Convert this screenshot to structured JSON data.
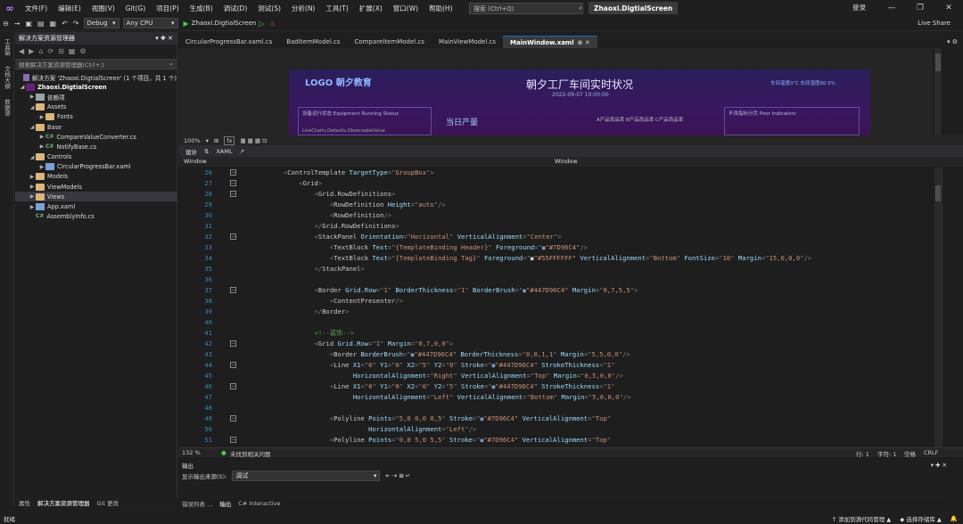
{
  "app": {
    "logo": "∞",
    "solution_title": "Zhaoxi.DigtialScreen",
    "login": "登录"
  },
  "menu": [
    "文件(F)",
    "编辑(E)",
    "视图(V)",
    "Git(G)",
    "项目(P)",
    "生成(B)",
    "调试(D)",
    "测试(S)",
    "分析(N)",
    "工具(T)",
    "扩展(X)",
    "窗口(W)",
    "帮助(H)"
  ],
  "search": {
    "placeholder": "搜索 (Ctrl+Q)"
  },
  "window_buttons": [
    "—",
    "❐",
    "✕"
  ],
  "toolbar": {
    "config": "Debug",
    "platform": "Any CPU",
    "run_target": "Zhaoxi.DigtialScreen",
    "live_share": "Live Share"
  },
  "vertical_tabs": [
    "工具箱",
    "文档大纲",
    "数据源"
  ],
  "solution_explorer": {
    "title": "解决方案资源管理器",
    "search_placeholder": "搜索解决方案资源管理器(Ctrl+;)",
    "items": [
      {
        "label": "解决方案 'Zhaoxi.DigtialScreen' (1 个项目，共 1 个)",
        "level": 0,
        "kind": "solution",
        "exp": ""
      },
      {
        "label": "Zhaoxi.DigtialScreen",
        "level": 0,
        "kind": "project",
        "exp": "◢"
      },
      {
        "label": "依赖项",
        "level": 1,
        "kind": "dep",
        "exp": "▶"
      },
      {
        "label": "Assets",
        "level": 1,
        "kind": "folder",
        "exp": "◢"
      },
      {
        "label": "Fonts",
        "level": 2,
        "kind": "folder",
        "exp": "▶"
      },
      {
        "label": "Base",
        "level": 1,
        "kind": "folder",
        "exp": "◢"
      },
      {
        "label": "CompareValueConverter.cs",
        "level": 2,
        "kind": "cs",
        "exp": "▶"
      },
      {
        "label": "NotifyBase.cs",
        "level": 2,
        "kind": "cs",
        "exp": "▶"
      },
      {
        "label": "Controls",
        "level": 1,
        "kind": "folder",
        "exp": "◢"
      },
      {
        "label": "CircularProgressBar.xaml",
        "level": 2,
        "kind": "xaml",
        "exp": "▶"
      },
      {
        "label": "Models",
        "level": 1,
        "kind": "folder",
        "exp": "▶"
      },
      {
        "label": "ViewModels",
        "level": 1,
        "kind": "folder",
        "exp": "▶"
      },
      {
        "label": "Views",
        "level": 1,
        "kind": "folder",
        "exp": "▶",
        "selected": true
      },
      {
        "label": "App.xaml",
        "level": 1,
        "kind": "xaml",
        "exp": "▶"
      },
      {
        "label": "AssemblyInfo.cs",
        "level": 1,
        "kind": "cs",
        "exp": ""
      }
    ],
    "bottom_tabs": [
      "属性",
      "解决方案资源管理器",
      "Git 更改"
    ]
  },
  "doc_tabs": [
    {
      "label": "CircularProgressBar.xaml.cs",
      "active": false
    },
    {
      "label": "BadItemModel.cs",
      "active": false
    },
    {
      "label": "CompareItemModel.cs",
      "active": false
    },
    {
      "label": "MainViewModel.cs",
      "active": false
    },
    {
      "label": "MainWindow.xaml",
      "active": true
    }
  ],
  "designer": {
    "logo": "LOGO 朝夕教育",
    "title": "朝夕工厂车间实时状况",
    "date": "2022-09-07 10:00:00",
    "right": "车间温度0℃  车间湿度60.5%",
    "panel1": "设备运行状态   Equipment Running Status",
    "panel2": "当日产量",
    "panel3": "A产品良品率    B产品良品率    C产品良品率",
    "panel4": "不良指标分页    Poor Indicators",
    "chart_lbl": "LiveCharts.Defaults.ObservableValue"
  },
  "design_bar": {
    "zoom": "100%",
    "fx": "fx",
    "design": "设计",
    "xaml": "XAML"
  },
  "crumb": {
    "left": "Window",
    "right": "Window"
  },
  "code_start": 26,
  "code_lines": [
    [
      [
        "            ",
        "t"
      ],
      [
        "<",
        "p"
      ],
      [
        "ControlTemplate ",
        "e"
      ],
      [
        "TargetType",
        "a"
      ],
      [
        "=\"",
        "p"
      ],
      [
        "GroupBox",
        "v"
      ],
      [
        "\">",
        "p"
      ]
    ],
    [
      [
        "                ",
        "t"
      ],
      [
        "<",
        "p"
      ],
      [
        "Grid",
        "e"
      ],
      [
        ">",
        "p"
      ]
    ],
    [
      [
        "                    ",
        "t"
      ],
      [
        "<",
        "p"
      ],
      [
        "Grid.RowDefinitions",
        "e"
      ],
      [
        ">",
        "p"
      ]
    ],
    [
      [
        "                        ",
        "t"
      ],
      [
        "<",
        "p"
      ],
      [
        "RowDefinition ",
        "e"
      ],
      [
        "Height",
        "a"
      ],
      [
        "=\"",
        "p"
      ],
      [
        "auto",
        "v"
      ],
      [
        "\"/>",
        "p"
      ]
    ],
    [
      [
        "                        ",
        "t"
      ],
      [
        "<",
        "p"
      ],
      [
        "RowDefinition",
        "e"
      ],
      [
        "/>",
        "p"
      ]
    ],
    [
      [
        "                    ",
        "t"
      ],
      [
        "</",
        "p"
      ],
      [
        "Grid.RowDefinitions",
        "e"
      ],
      [
        ">",
        "p"
      ]
    ],
    [
      [
        "                    ",
        "t"
      ],
      [
        "<",
        "p"
      ],
      [
        "StackPanel ",
        "e"
      ],
      [
        "Orientation",
        "a"
      ],
      [
        "=\"",
        "p"
      ],
      [
        "Horizontal",
        "v"
      ],
      [
        "\" ",
        "p"
      ],
      [
        "VerticalAlignment",
        "a"
      ],
      [
        "=\"",
        "p"
      ],
      [
        "Center",
        "v"
      ],
      [
        "\">",
        "p"
      ]
    ],
    [
      [
        "                        ",
        "t"
      ],
      [
        "<",
        "p"
      ],
      [
        "TextBlock ",
        "e"
      ],
      [
        "Text",
        "a"
      ],
      [
        "=\"",
        "p"
      ],
      [
        "{TemplateBinding Header}",
        "v"
      ],
      [
        "\" ",
        "p"
      ],
      [
        "Foreground",
        "a"
      ],
      [
        "=\"",
        "p"
      ],
      [
        "■",
        "s1"
      ],
      [
        "\"#7D96C4\"",
        "v"
      ],
      [
        "/>",
        "p"
      ]
    ],
    [
      [
        "                        ",
        "t"
      ],
      [
        "<",
        "p"
      ],
      [
        "TextBlock ",
        "e"
      ],
      [
        "Text",
        "a"
      ],
      [
        "=\"",
        "p"
      ],
      [
        "{TemplateBinding Tag}",
        "v"
      ],
      [
        "\" ",
        "p"
      ],
      [
        "Foreground",
        "a"
      ],
      [
        "=\"",
        "p"
      ],
      [
        "■",
        "s2"
      ],
      [
        "\"#55FFFFFF\" ",
        "v"
      ],
      [
        "VerticalAlignment",
        "a"
      ],
      [
        "=\"",
        "p"
      ],
      [
        "Bottom",
        "v"
      ],
      [
        "\" ",
        "p"
      ],
      [
        "FontSize",
        "a"
      ],
      [
        "=\"",
        "p"
      ],
      [
        "10",
        "v"
      ],
      [
        "\" ",
        "p"
      ],
      [
        "Margin",
        "a"
      ],
      [
        "=\"",
        "p"
      ],
      [
        "15,0,0,0",
        "v"
      ],
      [
        "\"/>",
        "p"
      ]
    ],
    [
      [
        "                    ",
        "t"
      ],
      [
        "</",
        "p"
      ],
      [
        "StackPanel",
        "e"
      ],
      [
        ">",
        "p"
      ]
    ],
    [
      [
        "",
        "t"
      ]
    ],
    [
      [
        "                    ",
        "t"
      ],
      [
        "<",
        "p"
      ],
      [
        "Border ",
        "e"
      ],
      [
        "Grid.Row",
        "a"
      ],
      [
        "=\"",
        "p"
      ],
      [
        "1",
        "v"
      ],
      [
        "\" ",
        "p"
      ],
      [
        "BorderThickness",
        "a"
      ],
      [
        "=\"",
        "p"
      ],
      [
        "1",
        "v"
      ],
      [
        "\" ",
        "p"
      ],
      [
        "BorderBrush",
        "a"
      ],
      [
        "=\"",
        "p"
      ],
      [
        "■",
        "s1"
      ],
      [
        "\"#447D96C4\" ",
        "v"
      ],
      [
        "Margin",
        "a"
      ],
      [
        "=\"",
        "p"
      ],
      [
        "0,7,5,5",
        "v"
      ],
      [
        "\">",
        "p"
      ]
    ],
    [
      [
        "                        ",
        "t"
      ],
      [
        "<",
        "p"
      ],
      [
        "ContentPresenter",
        "e"
      ],
      [
        "/>",
        "p"
      ]
    ],
    [
      [
        "                    ",
        "t"
      ],
      [
        "</",
        "p"
      ],
      [
        "Border",
        "e"
      ],
      [
        ">",
        "p"
      ]
    ],
    [
      [
        "",
        "t"
      ]
    ],
    [
      [
        "                    ",
        "t"
      ],
      [
        "<!--装饰-->",
        "c"
      ]
    ],
    [
      [
        "                    ",
        "t"
      ],
      [
        "<",
        "p"
      ],
      [
        "Grid ",
        "e"
      ],
      [
        "Grid.Row",
        "a"
      ],
      [
        "=\"",
        "p"
      ],
      [
        "1",
        "v"
      ],
      [
        "\" ",
        "p"
      ],
      [
        "Margin",
        "a"
      ],
      [
        "=\"",
        "p"
      ],
      [
        "0,7,0,0",
        "v"
      ],
      [
        "\">",
        "p"
      ]
    ],
    [
      [
        "                        ",
        "t"
      ],
      [
        "<",
        "p"
      ],
      [
        "Border ",
        "e"
      ],
      [
        "BorderBrush",
        "a"
      ],
      [
        "=\"",
        "p"
      ],
      [
        "■",
        "s1"
      ],
      [
        "\"#447D96C4\" ",
        "v"
      ],
      [
        "BorderThickness",
        "a"
      ],
      [
        "=\"",
        "p"
      ],
      [
        "0,0,1,1",
        "v"
      ],
      [
        "\" ",
        "p"
      ],
      [
        "Margin",
        "a"
      ],
      [
        "=\"",
        "p"
      ],
      [
        "5,5,0,0",
        "v"
      ],
      [
        "\"/>",
        "p"
      ]
    ],
    [
      [
        "                        ",
        "t"
      ],
      [
        "<",
        "p"
      ],
      [
        "Line ",
        "e"
      ],
      [
        "X1",
        "a"
      ],
      [
        "=\"",
        "p"
      ],
      [
        "0",
        "v"
      ],
      [
        "\" ",
        "p"
      ],
      [
        "Y1",
        "a"
      ],
      [
        "=\"",
        "p"
      ],
      [
        "0",
        "v"
      ],
      [
        "\" ",
        "p"
      ],
      [
        "X2",
        "a"
      ],
      [
        "=\"",
        "p"
      ],
      [
        "5",
        "v"
      ],
      [
        "\" ",
        "p"
      ],
      [
        "Y2",
        "a"
      ],
      [
        "=\"",
        "p"
      ],
      [
        "0",
        "v"
      ],
      [
        "\" ",
        "p"
      ],
      [
        "Stroke",
        "a"
      ],
      [
        "=\"",
        "p"
      ],
      [
        "■",
        "s1"
      ],
      [
        "\"#447D96C4\" ",
        "v"
      ],
      [
        "StrokeThickness",
        "a"
      ],
      [
        "=\"",
        "p"
      ],
      [
        "1",
        "v"
      ],
      [
        "\"",
        "p"
      ]
    ],
    [
      [
        "                              ",
        "t"
      ],
      [
        "HorizontalAlignment",
        "a"
      ],
      [
        "=\"",
        "p"
      ],
      [
        "Right",
        "v"
      ],
      [
        "\" ",
        "p"
      ],
      [
        "VerticalAlignment",
        "a"
      ],
      [
        "=\"",
        "p"
      ],
      [
        "Top",
        "v"
      ],
      [
        "\" ",
        "p"
      ],
      [
        "Margin",
        "a"
      ],
      [
        "=\"",
        "p"
      ],
      [
        "0,5,0,0",
        "v"
      ],
      [
        "\"/>",
        "p"
      ]
    ],
    [
      [
        "                        ",
        "t"
      ],
      [
        "<",
        "p"
      ],
      [
        "Line ",
        "e"
      ],
      [
        "X1",
        "a"
      ],
      [
        "=\"",
        "p"
      ],
      [
        "0",
        "v"
      ],
      [
        "\" ",
        "p"
      ],
      [
        "Y1",
        "a"
      ],
      [
        "=\"",
        "p"
      ],
      [
        "0",
        "v"
      ],
      [
        "\" ",
        "p"
      ],
      [
        "X2",
        "a"
      ],
      [
        "=\"",
        "p"
      ],
      [
        "0",
        "v"
      ],
      [
        "\" ",
        "p"
      ],
      [
        "Y2",
        "a"
      ],
      [
        "=\"",
        "p"
      ],
      [
        "5",
        "v"
      ],
      [
        "\" ",
        "p"
      ],
      [
        "Stroke",
        "a"
      ],
      [
        "=\"",
        "p"
      ],
      [
        "■",
        "s1"
      ],
      [
        "\"#447D96C4\" ",
        "v"
      ],
      [
        "StrokeThickness",
        "a"
      ],
      [
        "=\"",
        "p"
      ],
      [
        "1",
        "v"
      ],
      [
        "\"",
        "p"
      ]
    ],
    [
      [
        "                              ",
        "t"
      ],
      [
        "HorizontalAlignment",
        "a"
      ],
      [
        "=\"",
        "p"
      ],
      [
        "Left",
        "v"
      ],
      [
        "\" ",
        "p"
      ],
      [
        "VerticalAlignment",
        "a"
      ],
      [
        "=\"",
        "p"
      ],
      [
        "Bottom",
        "v"
      ],
      [
        "\" ",
        "p"
      ],
      [
        "Margin",
        "a"
      ],
      [
        "=\"",
        "p"
      ],
      [
        "5,0,0,0",
        "v"
      ],
      [
        "\"/>",
        "p"
      ]
    ],
    [
      [
        "",
        "t"
      ]
    ],
    [
      [
        "                        ",
        "t"
      ],
      [
        "<",
        "p"
      ],
      [
        "Polyline ",
        "e"
      ],
      [
        "Points",
        "a"
      ],
      [
        "=\"",
        "p"
      ],
      [
        "5,0 0,0 0,5",
        "v"
      ],
      [
        "\" ",
        "p"
      ],
      [
        "Stroke",
        "a"
      ],
      [
        "=\"",
        "p"
      ],
      [
        "■",
        "s3"
      ],
      [
        "\"#7D96C4\" ",
        "v"
      ],
      [
        "VerticalAlignment",
        "a"
      ],
      [
        "=\"",
        "p"
      ],
      [
        "Top",
        "v"
      ],
      [
        "\"",
        "p"
      ]
    ],
    [
      [
        "                                  ",
        "t"
      ],
      [
        "HorizontalAlignment",
        "a"
      ],
      [
        "=\"",
        "p"
      ],
      [
        "Left",
        "v"
      ],
      [
        "\"/>",
        "p"
      ]
    ],
    [
      [
        "                        ",
        "t"
      ],
      [
        "<",
        "p"
      ],
      [
        "Polyline ",
        "e"
      ],
      [
        "Points",
        "a"
      ],
      [
        "=\"",
        "p"
      ],
      [
        "0,0 5,0 5,5",
        "v"
      ],
      [
        "\" ",
        "p"
      ],
      [
        "Stroke",
        "a"
      ],
      [
        "=\"",
        "p"
      ],
      [
        "■",
        "s3"
      ],
      [
        "\"#7D96C4\" ",
        "v"
      ],
      [
        "VerticalAlignment",
        "a"
      ],
      [
        "=\"",
        "p"
      ],
      [
        "Top",
        "v"
      ],
      [
        "\"",
        "p"
      ]
    ]
  ],
  "editor_status": {
    "zoom": "132 %",
    "issues": "未找到相关问题",
    "line": "行: 1",
    "char": "字符: 1",
    "space": "空格",
    "eol": "CRLF"
  },
  "output": {
    "title": "输出",
    "source_label": "显示输出来源(S):",
    "source_value": "调试",
    "tabs": [
      "错误列表 ...",
      "输出",
      "C# Interactive"
    ]
  },
  "statusbar": {
    "ready": "就绪",
    "add_source": "↑ 添加到源代码管理 ▲",
    "select_repo": "◆ 选择存储库 ▲"
  },
  "colors": {
    "p": "#808080",
    "e": "#c8c8c8",
    "a": "#9cdcfe",
    "v": "#ce9178",
    "c": "#57a64a",
    "t": "#d4d4d4",
    "s1": "#7d96c4",
    "s2": "#cccccc",
    "s3": "#7d96c4"
  }
}
